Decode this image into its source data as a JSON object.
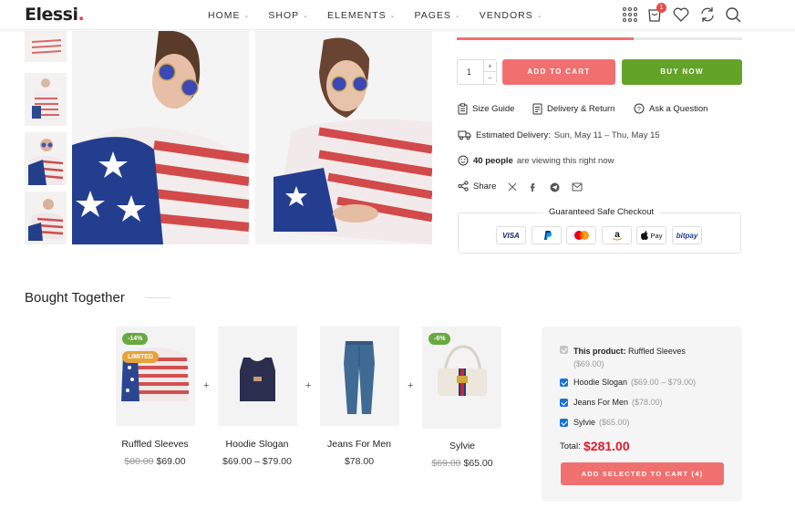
{
  "header": {
    "logo_text": "Elessi",
    "logo_dot": ".",
    "nav": [
      {
        "label": "HOME"
      },
      {
        "label": "SHOP"
      },
      {
        "label": "ELEMENTS"
      },
      {
        "label": "PAGES"
      },
      {
        "label": "VENDORS"
      }
    ],
    "cart_count": "1",
    "icons": [
      "apps-grid-icon",
      "cart-icon",
      "heart-icon",
      "compare-icon",
      "search-icon"
    ]
  },
  "product": {
    "stock_progress": 0.62,
    "quantity": "1",
    "add_to_cart_label": "ADD TO CART",
    "buy_now_label": "BUY NOW",
    "size_guide": "Size Guide",
    "delivery_return": "Delivery & Return",
    "ask_question": "Ask a Question",
    "estimated_delivery_label": "Estimated Delivery:",
    "estimated_delivery_value": "Sun, May 11 – Thu, May 15",
    "viewing_count": "40 people",
    "viewing_text": "are viewing this right now",
    "share_label": "Share",
    "checkout_title": "Guaranteed Safe Checkout",
    "payments": [
      "VISA",
      "PayPal",
      "Mastercard",
      "Amazon",
      "Apple Pay",
      "bitpay"
    ]
  },
  "bought_together": {
    "title": "Bought Together",
    "items": [
      {
        "name": "Ruffled Sleeves",
        "old_price": "$80.00",
        "price": "$69.00",
        "badge_sale": "-14%",
        "badge_limited": "LIMITED"
      },
      {
        "name": "Hoodie Slogan",
        "price": "$69.00 – $79.00"
      },
      {
        "name": "Jeans For Men",
        "price": "$78.00"
      },
      {
        "name": "Sylvie",
        "old_price": "$69.00",
        "price": "$65.00",
        "badge_sale": "-6%"
      }
    ],
    "summary": {
      "this_product_label": "This product:",
      "this_product_name": "Ruffled Sleeves",
      "this_product_price": "($69.00)",
      "rows": [
        {
          "name": "Hoodie Slogan",
          "price": "($69.00 – $79.00)"
        },
        {
          "name": "Jeans For Men",
          "price": "($78.00)"
        },
        {
          "name": "Sylvie",
          "price": "($65.00)"
        }
      ],
      "total_label": "Total:",
      "total_value": "$281.00",
      "add_selected_label": "ADD SELECTED TO CART (4)"
    }
  },
  "colors": {
    "accent_red": "#f07070",
    "buy_green": "#62a328",
    "total_red": "#e3192b",
    "checkbox_blue": "#1872d6"
  }
}
